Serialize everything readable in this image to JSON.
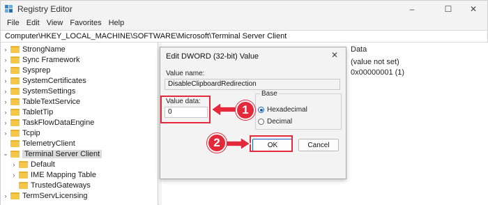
{
  "window": {
    "title": "Registry Editor",
    "controls": {
      "minimize": "–",
      "maximize": "☐",
      "close": "✕"
    }
  },
  "menu": [
    "File",
    "Edit",
    "View",
    "Favorites",
    "Help"
  ],
  "address": "Computer\\HKEY_LOCAL_MACHINE\\SOFTWARE\\Microsoft\\Terminal Server Client",
  "tree": {
    "items": [
      {
        "label": "StrongName",
        "expand": "›"
      },
      {
        "label": "Sync Framework",
        "expand": "›"
      },
      {
        "label": "Sysprep",
        "expand": "›"
      },
      {
        "label": "SystemCertificates",
        "expand": "›"
      },
      {
        "label": "SystemSettings",
        "expand": "›"
      },
      {
        "label": "TableTextService",
        "expand": "›"
      },
      {
        "label": "TabletTip",
        "expand": "›"
      },
      {
        "label": "TaskFlowDataEngine",
        "expand": "›"
      },
      {
        "label": "Tcpip",
        "expand": "›"
      },
      {
        "label": "TelemetryClient",
        "expand": ""
      },
      {
        "label": "Terminal Server Client",
        "expand": "⌄"
      },
      {
        "label": "Default",
        "expand": "›"
      },
      {
        "label": "IME Mapping Table",
        "expand": "›"
      },
      {
        "label": "TrustedGateways",
        "expand": ""
      },
      {
        "label": "TermServLicensing",
        "expand": "›"
      }
    ]
  },
  "list": {
    "data_header": "Data",
    "rows": [
      {
        "data": "(value not set)"
      },
      {
        "data": "0x00000001 (1)"
      }
    ]
  },
  "dialog": {
    "title": "Edit DWORD (32-bit) Value",
    "close": "✕",
    "value_name_label": "Value name:",
    "value_name": "DisableClipboardRedirection",
    "value_data_label": "Value data:",
    "value_data": "0",
    "base_label": "Base",
    "base_options": [
      {
        "label": "Hexadecimal",
        "selected": true
      },
      {
        "label": "Decimal",
        "selected": false
      }
    ],
    "ok_label": "OK",
    "cancel_label": "Cancel"
  },
  "annotations": {
    "step1": "1",
    "step2": "2",
    "accent": "#e5283a"
  }
}
